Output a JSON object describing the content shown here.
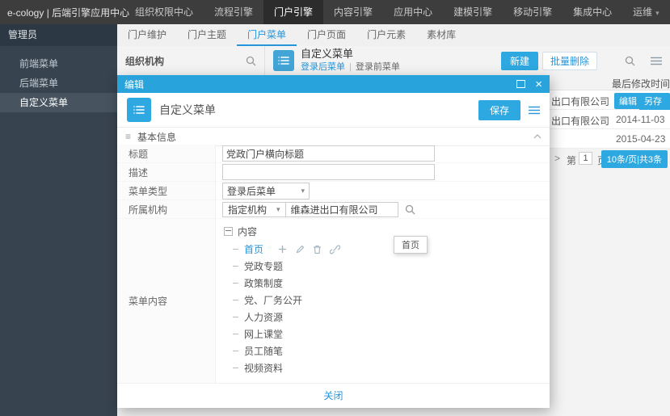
{
  "topbar": {
    "logo": "e-cology | 后端引擎应用中心",
    "nav": [
      {
        "label": "组织权限中心"
      },
      {
        "label": "流程引擎"
      },
      {
        "label": "门户引擎"
      },
      {
        "label": "内容引擎"
      },
      {
        "label": "应用中心"
      },
      {
        "label": "建模引擎"
      },
      {
        "label": "移动引擎"
      },
      {
        "label": "集成中心"
      },
      {
        "label": "运维"
      }
    ]
  },
  "subnav": {
    "tabs": [
      {
        "label": "门户维护"
      },
      {
        "label": "门户主题"
      },
      {
        "label": "门户菜单"
      },
      {
        "label": "门户页面"
      },
      {
        "label": "门户元素"
      },
      {
        "label": "素材库"
      }
    ]
  },
  "sidebar": {
    "header": "管理员",
    "items": [
      {
        "label": "前端菜单"
      },
      {
        "label": "后端菜单"
      },
      {
        "label": "自定义菜单"
      }
    ]
  },
  "page": {
    "org_panel_title": "组织机构",
    "title": "自定义菜单",
    "links": {
      "after_login": "登录后菜单",
      "separator": "|",
      "before_login": "登录前菜单"
    },
    "buttons": {
      "new": "新建",
      "batch_delete": "批量删除"
    }
  },
  "table": {
    "modified_header": "最后修改时间",
    "rows": [
      {
        "name_fragment": "出口有限公司",
        "edit": "编辑",
        "save_as": "另存为"
      },
      {
        "name_fragment": "出口有限公司",
        "modified": "2014-11-03"
      },
      {
        "modified": "2015-04-23"
      }
    ],
    "pagination": {
      "next_symbol": ">",
      "page_prefix": "第",
      "page_value": "1",
      "page_suffix": "页",
      "size_total": "10条/页|共3条"
    }
  },
  "modal": {
    "title": "编辑",
    "header_title": "自定义菜单",
    "save_button": "保存",
    "section_title": "基本信息",
    "fields": {
      "title_label": "标题",
      "title_value": "党政门户横向标题",
      "desc_label": "描述",
      "desc_value": "",
      "type_label": "菜单类型",
      "type_value": "登录后菜单",
      "org_label": "所属机构",
      "org_mode": "指定机构",
      "org_value": "维森进出口有限公司",
      "content_label": "菜单内容"
    },
    "tree": {
      "root_label": "内容",
      "items": [
        {
          "label": "首页"
        },
        {
          "label": "党政专题"
        },
        {
          "label": "政策制度"
        },
        {
          "label": "党、厂务公开"
        },
        {
          "label": "人力资源"
        },
        {
          "label": "网上课堂"
        },
        {
          "label": "员工随笔"
        },
        {
          "label": "视频资料"
        }
      ],
      "tooltip": "首页"
    },
    "close_button": "关闭"
  }
}
